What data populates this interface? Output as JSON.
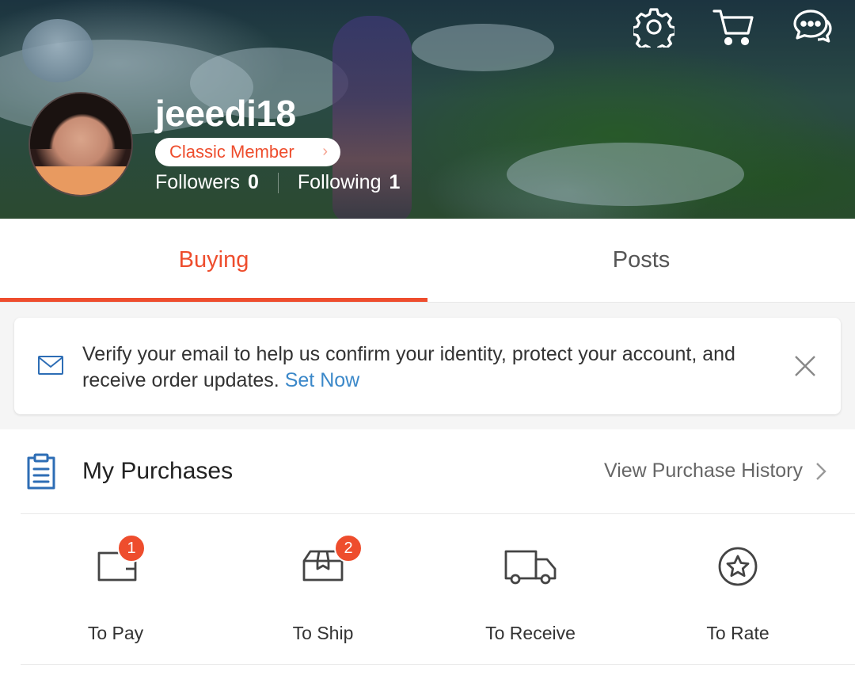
{
  "header": {
    "username": "jeeedi18",
    "member_tier": "Classic Member",
    "followers_label": "Followers",
    "followers_count": "0",
    "following_label": "Following",
    "following_count": "1",
    "icons": [
      "gear-icon",
      "cart-icon",
      "chat-icon"
    ]
  },
  "tabs": [
    {
      "label": "Buying",
      "active": true
    },
    {
      "label": "Posts",
      "active": false
    }
  ],
  "notice": {
    "text": "Verify your email to help us confirm your identity, protect your account, and receive order updates.",
    "action": "Set Now",
    "icon": "mail-icon",
    "close_icon": "close-icon"
  },
  "purchases": {
    "title": "My Purchases",
    "history_link": "View Purchase History",
    "statuses": [
      {
        "label": "To Pay",
        "icon": "wallet-icon",
        "badge": "1"
      },
      {
        "label": "To Ship",
        "icon": "box-icon",
        "badge": "2"
      },
      {
        "label": "To Receive",
        "icon": "truck-icon",
        "badge": ""
      },
      {
        "label": "To Rate",
        "icon": "star-icon",
        "badge": ""
      }
    ]
  },
  "colors": {
    "accent": "#ee4d2d",
    "link": "#3b88c9",
    "icon_blue": "#2d6db5"
  }
}
